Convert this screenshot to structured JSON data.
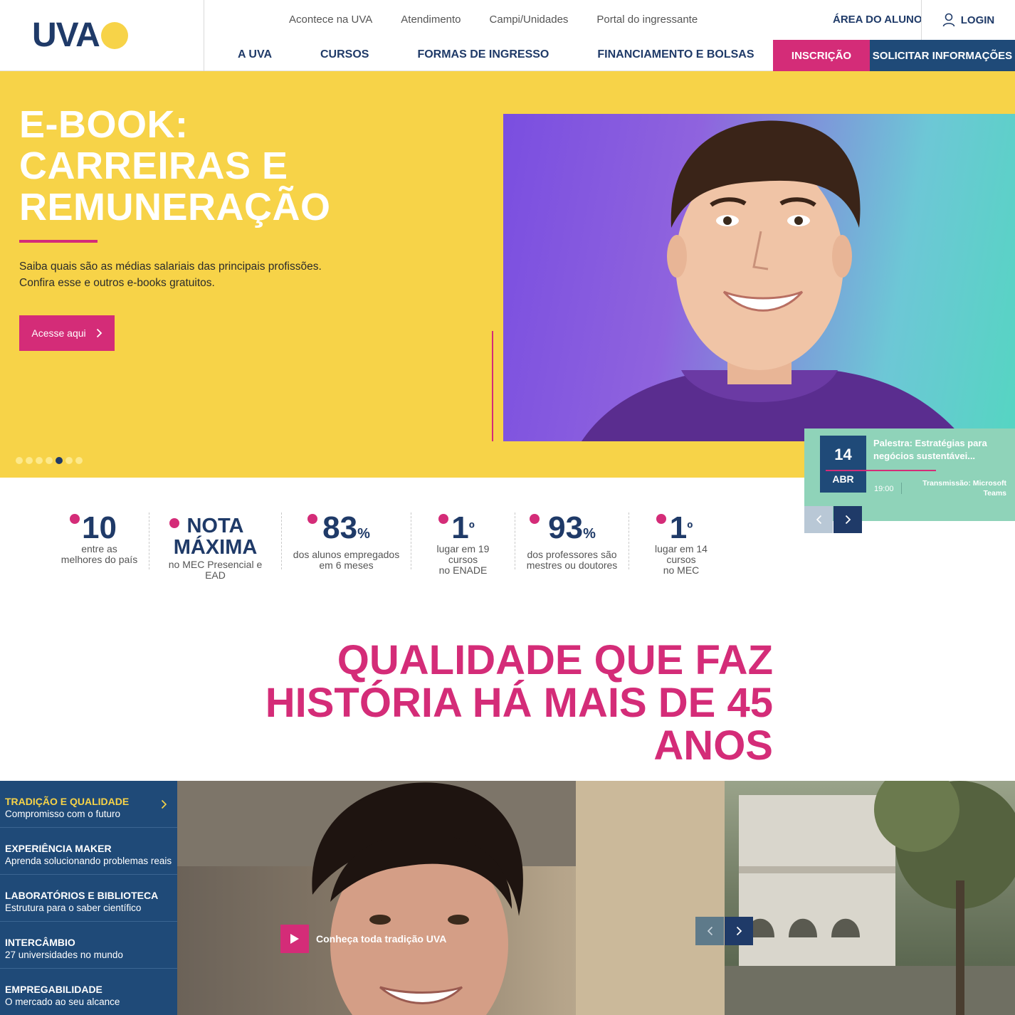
{
  "header": {
    "logo_text": "UVA",
    "util_links": [
      "Acontece na UVA",
      "Atendimento",
      "Campi/Unidades",
      "Portal do ingressante"
    ],
    "aluno_label": "ÁREA DO ALUNO",
    "login_label": "LOGIN",
    "main_nav": [
      "A UVA",
      "CURSOS",
      "FORMAS DE INGRESSO",
      "FINANCIAMENTO E BOLSAS"
    ],
    "inscricao_label": "INSCRIÇÃO",
    "info_label": "SOLICITAR INFORMAÇÕES"
  },
  "hero": {
    "title_lines": [
      "E-BOOK:",
      "CARREIRAS E",
      "REMUNERAÇÃO"
    ],
    "text_lines": [
      "Saiba quais são as médias salariais das principais profissões.",
      "Confira esse e outros e-books gratuitos."
    ],
    "button_label": "Acesse aqui",
    "slides_total": 7,
    "slide_active": 5
  },
  "event": {
    "day": "14",
    "month": "ABR",
    "title": "Palestra: Estratégias para negócios sustentávei...",
    "time": "19:00",
    "where": "Transmissão: Microsoft Teams"
  },
  "stats": [
    {
      "big": "10",
      "sub": [
        "entre as",
        "melhores do país"
      ]
    },
    {
      "word1": "NOTA",
      "word2": "MÁXIMA",
      "sub": [
        "no MEC Presencial e EAD"
      ]
    },
    {
      "big": "83",
      "suffix": "%",
      "sub": [
        "dos alunos empregados",
        "em 6 meses"
      ]
    },
    {
      "big": "1",
      "suffix": "º",
      "sub": [
        "lugar em 19 cursos",
        "no ENADE"
      ]
    },
    {
      "big": "93",
      "suffix": "%",
      "sub": [
        "dos professores são",
        "mestres ou doutores"
      ]
    },
    {
      "big": "1",
      "suffix": "º",
      "sub": [
        "lugar em 14 cursos",
        "no MEC"
      ]
    }
  ],
  "section": {
    "title_lines": [
      "QUALIDADE QUE FAZ",
      "HISTÓRIA HÁ MAIS DE 45",
      "ANOS"
    ]
  },
  "side_menu": [
    {
      "title": "TRADIÇÃO E QUALIDADE",
      "subtitle": "Compromisso com o futuro"
    },
    {
      "title": "EXPERIÊNCIA MAKER",
      "subtitle": "Aprenda solucionando problemas reais"
    },
    {
      "title": "LABORATÓRIOS E BIBLIOTECA",
      "subtitle": "Estrutura para o saber científico"
    },
    {
      "title": "INTERCÂMBIO",
      "subtitle": "27 universidades no mundo"
    },
    {
      "title": "EMPREGABILIDADE",
      "subtitle": "O mercado ao seu alcance"
    }
  ],
  "video": {
    "label": "Conheça toda tradição UVA"
  },
  "colors": {
    "navy": "#1f3a68",
    "yellow": "#f7d348",
    "pink": "#d42c78",
    "blue_panel": "#1f4a78",
    "mint": "#8fd3b9"
  },
  "icons": [
    "user-icon",
    "chevron-right-icon",
    "chevron-left-icon",
    "play-icon"
  ]
}
